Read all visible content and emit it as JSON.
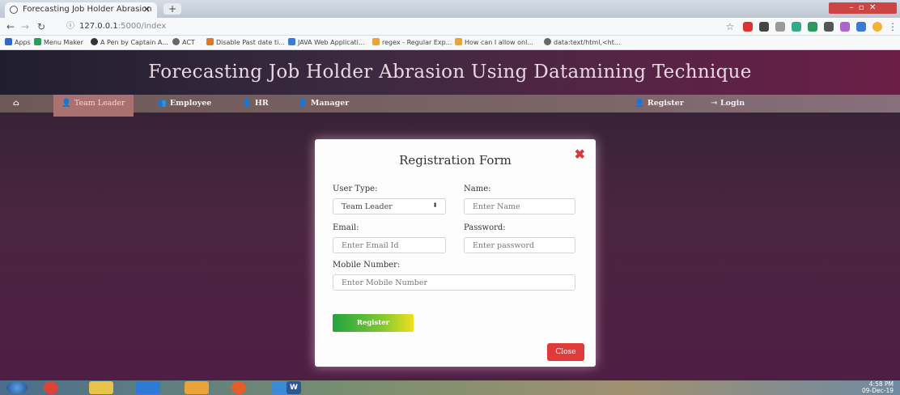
{
  "browser": {
    "tab_title": "Forecasting Job Holder Abrasion",
    "url_host": "127.0.0.1",
    "url_path": ":5000/index",
    "bookmarks": [
      "Apps",
      "Menu Maker",
      "A Pen by Captain A...",
      "ACT",
      "Disable Past date ti...",
      "JAVA Web Applicati...",
      "regex - Regular Exp...",
      "How can I allow onl...",
      "data:text/html,<ht..."
    ]
  },
  "site": {
    "title": "Forecasting Job Holder Abrasion Using Datamining Technique"
  },
  "nav": {
    "team_leader": "Team Leader",
    "employee": "Employee",
    "hr": "HR",
    "manager": "Manager",
    "register": "Register",
    "login": "Login"
  },
  "modal": {
    "title": "Registration Form",
    "user_type_label": "User Type:",
    "user_type_value": "Team Leader",
    "name_label": "Name:",
    "name_placeholder": "Enter Name",
    "email_label": "Email:",
    "email_placeholder": "Enter Email Id",
    "password_label": "Password:",
    "password_placeholder": "Enter password",
    "mobile_label": "Mobile Number:",
    "mobile_placeholder": "Enter Mobile Number",
    "register_button": "Register",
    "close_button": "Close"
  },
  "taskbar": {
    "time": "4:58 PM",
    "date": "09-Dec-19"
  }
}
